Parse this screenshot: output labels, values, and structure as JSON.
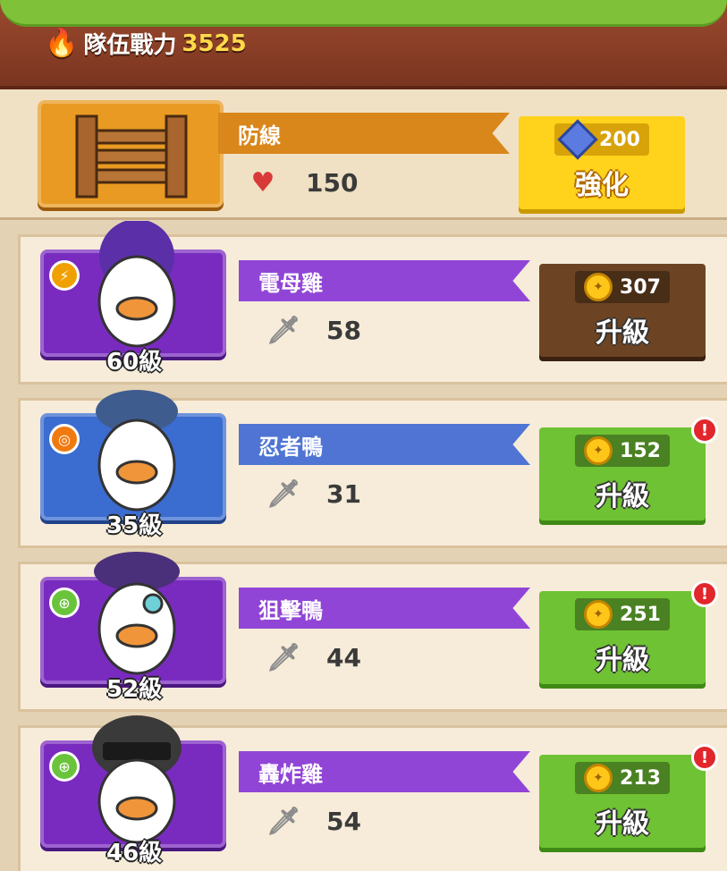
{
  "header": {
    "label": "隊伍戰力",
    "value": "3525",
    "fire_icon": "fire-icon"
  },
  "fence": {
    "name": "防線",
    "stat": "150",
    "stat_icon": "heart-icon",
    "button": {
      "cost": "200",
      "label": "強化",
      "cost_icon": "gem-icon"
    }
  },
  "units": [
    {
      "name": "電母雞",
      "level": "60級",
      "stat": "58",
      "stat_icon": "sword-icon",
      "button": {
        "cost": "307",
        "label": "升級",
        "style": "brown",
        "alert": false
      }
    },
    {
      "name": "忍者鴨",
      "level": "35級",
      "stat": "31",
      "stat_icon": "sword-icon",
      "button": {
        "cost": "152",
        "label": "升級",
        "style": "green",
        "alert": true
      }
    },
    {
      "name": "狙擊鴨",
      "level": "52級",
      "stat": "44",
      "stat_icon": "sword-icon",
      "button": {
        "cost": "251",
        "label": "升級",
        "style": "green",
        "alert": true
      }
    },
    {
      "name": "轟炸雞",
      "level": "46級",
      "stat": "54",
      "stat_icon": "sword-icon",
      "button": {
        "cost": "213",
        "label": "升級",
        "style": "green",
        "alert": true
      }
    }
  ],
  "alert_mark": "!"
}
